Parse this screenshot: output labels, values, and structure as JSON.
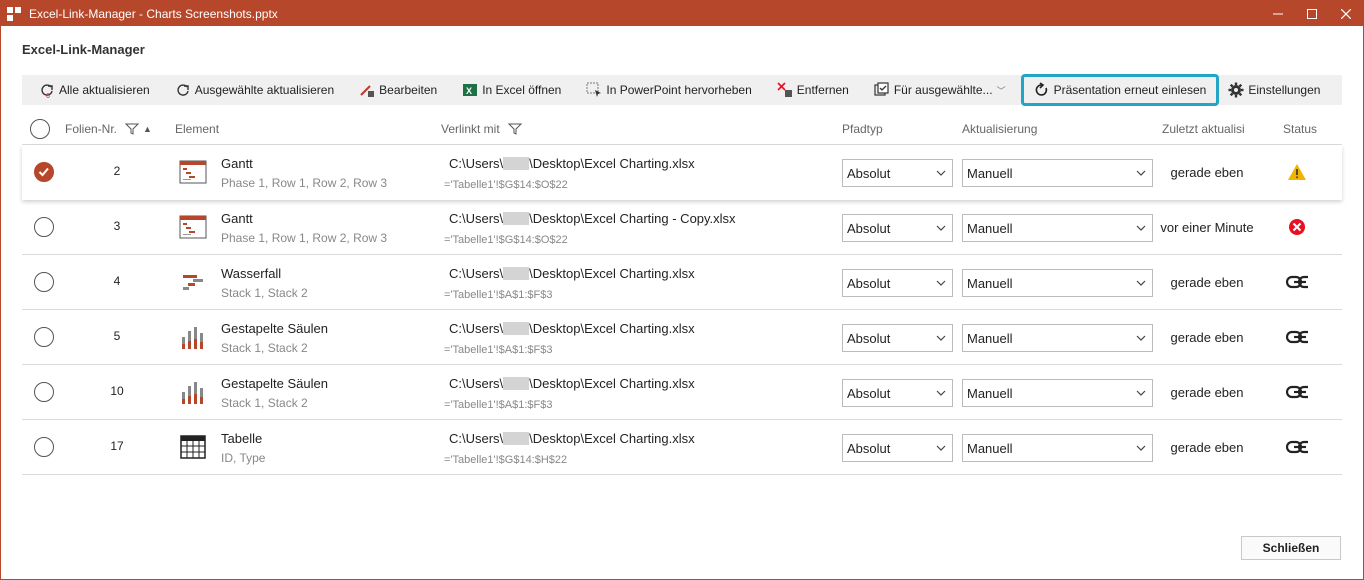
{
  "window": {
    "title": "Excel-Link-Manager - Charts Screenshots.pptx",
    "app_title": "Excel-Link-Manager"
  },
  "toolbar": {
    "update_all": "Alle aktualisieren",
    "update_selected": "Ausgewählte aktualisieren",
    "edit": "Bearbeiten",
    "open_excel": "In Excel öffnen",
    "highlight_ppt": "In PowerPoint hervorheben",
    "remove": "Entfernen",
    "for_selected": "Für ausgewählte...",
    "reimport": "Präsentation erneut einlesen",
    "settings": "Einstellungen"
  },
  "columns": {
    "slide_no": "Folien-Nr.",
    "element": "Element",
    "linked_with": "Verlinkt mit",
    "path_type": "Pfadtyp",
    "update": "Aktualisierung",
    "last_updated": "Zuletzt aktualisi",
    "status": "Status"
  },
  "rows": [
    {
      "checked": true,
      "slide": "2",
      "icon": "gantt-icon",
      "name": "Gantt",
      "sub": "Phase 1, Row 1, Row 2, Row 3",
      "path_pre": "C:\\Users\\",
      "path_post": "\\Desktop\\Excel Charting.xlsx",
      "range": "='Tabelle1'!$G$14:$O$22",
      "path_type": "Absolut",
      "update": "Manuell",
      "last": "gerade eben",
      "status": "warning-icon"
    },
    {
      "checked": false,
      "slide": "3",
      "icon": "gantt-icon",
      "name": "Gantt",
      "sub": "Phase 1, Row 1, Row 2, Row 3",
      "path_pre": "C:\\Users\\",
      "path_post": "\\Desktop\\Excel Charting - Copy.xlsx",
      "range": "='Tabelle1'!$G$14:$O$22",
      "path_type": "Absolut",
      "update": "Manuell",
      "last": "vor einer Minute",
      "status": "error-icon"
    },
    {
      "checked": false,
      "slide": "4",
      "icon": "waterfall-icon",
      "name": "Wasserfall",
      "sub": "Stack 1, Stack 2",
      "path_pre": "C:\\Users\\",
      "path_post": "\\Desktop\\Excel Charting.xlsx",
      "range": "='Tabelle1'!$A$1:$F$3",
      "path_type": "Absolut",
      "update": "Manuell",
      "last": "gerade eben",
      "status": "link-icon"
    },
    {
      "checked": false,
      "slide": "5",
      "icon": "stacked-columns-icon",
      "name": "Gestapelte Säulen",
      "sub": "Stack 1, Stack 2",
      "path_pre": "C:\\Users\\",
      "path_post": "\\Desktop\\Excel Charting.xlsx",
      "range": "='Tabelle1'!$A$1:$F$3",
      "path_type": "Absolut",
      "update": "Manuell",
      "last": "gerade eben",
      "status": "link-icon"
    },
    {
      "checked": false,
      "slide": "10",
      "icon": "stacked-columns-icon",
      "name": "Gestapelte Säulen",
      "sub": "Stack 1, Stack 2",
      "path_pre": "C:\\Users\\",
      "path_post": "\\Desktop\\Excel Charting.xlsx",
      "range": "='Tabelle1'!$A$1:$F$3",
      "path_type": "Absolut",
      "update": "Manuell",
      "last": "gerade eben",
      "status": "link-icon"
    },
    {
      "checked": false,
      "slide": "17",
      "icon": "table-icon",
      "name": "Tabelle",
      "sub": "ID, Type",
      "path_pre": "C:\\Users\\",
      "path_post": "\\Desktop\\Excel Charting.xlsx",
      "range": "='Tabelle1'!$G$14:$H$22",
      "path_type": "Absolut",
      "update": "Manuell",
      "last": "gerade eben",
      "status": "link-icon"
    }
  ],
  "footer": {
    "close": "Schließen"
  },
  "colors": {
    "accent": "#b7472a",
    "highlight": "#22a6c8",
    "warning": "#f0b400",
    "error": "#e81123"
  }
}
